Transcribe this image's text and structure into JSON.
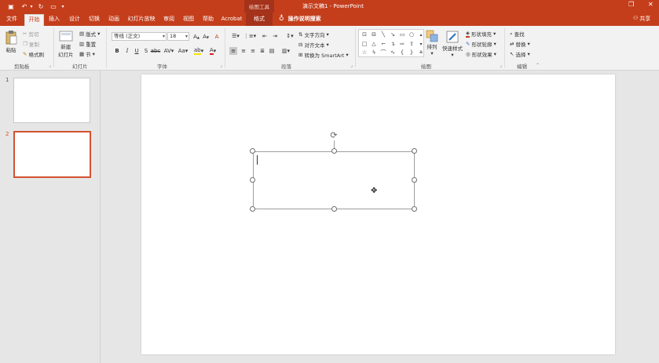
{
  "titlebar": {
    "tools_title": "绘图工具",
    "document_title": "演示文稿1 - PowerPoint",
    "quick_access": [
      {
        "name": "save-icon",
        "glyph": "💾"
      },
      {
        "name": "undo-icon",
        "glyph": "↶"
      },
      {
        "name": "undo-dropdown-icon",
        "glyph": "▾"
      },
      {
        "name": "redo-icon",
        "glyph": "↻"
      },
      {
        "name": "start-from-beginning-icon",
        "glyph": "⎚"
      },
      {
        "name": "customize-qat-icon",
        "glyph": "▾"
      }
    ],
    "window_buttons": {
      "restore": "❐",
      "close": "✕"
    }
  },
  "tabs": [
    {
      "id": "file",
      "label": "文件"
    },
    {
      "id": "home",
      "label": "开始",
      "active": true
    },
    {
      "id": "insert",
      "label": "插入"
    },
    {
      "id": "design",
      "label": "设计"
    },
    {
      "id": "transitions",
      "label": "切换"
    },
    {
      "id": "animations",
      "label": "动画"
    },
    {
      "id": "slideshow",
      "label": "幻灯片放映"
    },
    {
      "id": "review",
      "label": "审阅"
    },
    {
      "id": "view",
      "label": "视图"
    },
    {
      "id": "help",
      "label": "帮助"
    },
    {
      "id": "acrobat",
      "label": "Acrobat"
    },
    {
      "id": "format",
      "label": "格式"
    }
  ],
  "tellme": {
    "icon": "lightbulb-icon",
    "label": "操作说明搜索"
  },
  "share": {
    "label": "共享"
  },
  "ribbon": {
    "clipboard": {
      "label": "剪贴板",
      "paste": "粘贴",
      "cut": "剪切",
      "copy": "复制",
      "format_painter": "格式刷"
    },
    "slides": {
      "label": "幻灯片",
      "new_slide": "新建",
      "new_slide_line2": "幻灯片",
      "layout": "版式",
      "reset": "重置",
      "section": "节"
    },
    "font": {
      "label": "字体",
      "font_name": "等线 (正文)",
      "font_size": "18"
    },
    "paragraph": {
      "label": "段落",
      "text_direction": "文字方向",
      "align_text": "对齐文本",
      "convert_smartart": "转换为 SmartArt"
    },
    "drawing": {
      "label": "绘图",
      "arrange": "排列",
      "quick_styles": "快速样式",
      "shape_fill": "形状填充",
      "shape_outline": "形状轮廓",
      "shape_effects": "形状效果"
    },
    "editing": {
      "label": "编辑",
      "find": "查找",
      "replace": "替换",
      "select": "选择"
    }
  },
  "thumbnails": [
    {
      "number": "1"
    },
    {
      "number": "2",
      "active": true
    }
  ]
}
